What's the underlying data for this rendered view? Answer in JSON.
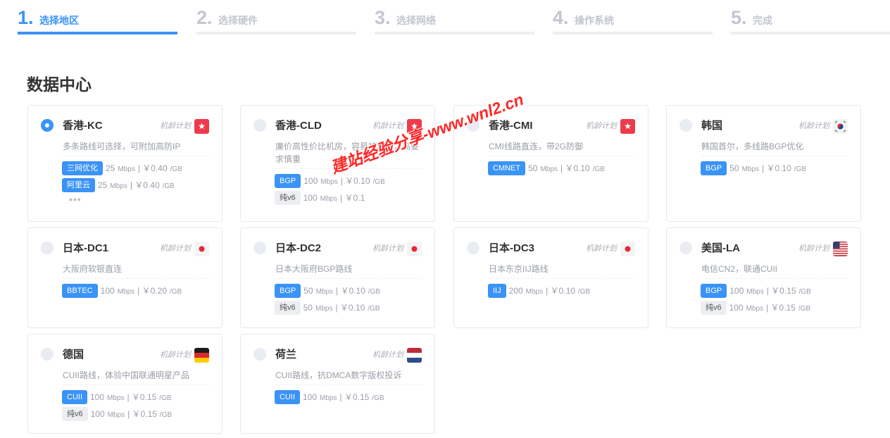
{
  "steps": [
    {
      "num": "1.",
      "label": "选择地区",
      "active": true
    },
    {
      "num": "2.",
      "label": "选择硬件",
      "active": false
    },
    {
      "num": "3.",
      "label": "选择网络",
      "active": false
    },
    {
      "num": "4.",
      "label": "操作系统",
      "active": false
    },
    {
      "num": "5.",
      "label": "完成",
      "active": false
    }
  ],
  "section_title": "数据中心",
  "watermark": "建站经验分享-www.wnl2.cn",
  "colors": {
    "accent": "#3a93f7",
    "muted": "#c3c6cf"
  },
  "datacenters": [
    {
      "name": "香港-KC",
      "plan": "机龄计划",
      "flag": "hk-flag-icon",
      "selected": true,
      "desc": "多条路线可选择，可附加高防IP",
      "lines": [
        {
          "tag": "三网优化",
          "speed": "25",
          "unit": "Mbps",
          "price": "| ￥0.40",
          "per": "/GB"
        },
        {
          "tag": "阿里云",
          "speed": "25",
          "unit": "Mbps",
          "price": "| ￥0.40",
          "per": "/GB"
        }
      ],
      "more": "•••"
    },
    {
      "name": "香港-CLD",
      "plan": "机龄计划",
      "flag": "hk-flag-icon",
      "selected": false,
      "desc": "廉价高性价比机房，容易被攻击，高要求慎重",
      "lines": [
        {
          "tag": "BGP",
          "speed": "100",
          "unit": "Mbps",
          "price": "| ￥0.10",
          "per": "/GB"
        },
        {
          "tag": "纯v6",
          "speed": "100",
          "unit": "Mbps",
          "price": "| ￥0.1",
          "per": "",
          "gray": true
        }
      ]
    },
    {
      "name": "香港-CMI",
      "plan": "机龄计划",
      "flag": "hk-flag-icon",
      "selected": false,
      "desc": "CMI线路直连，带2G防御",
      "lines": [
        {
          "tag": "CMNET",
          "speed": "50",
          "unit": "Mbps",
          "price": "| ￥0.10",
          "per": "/GB"
        }
      ]
    },
    {
      "name": "韩国",
      "plan": "机龄计划",
      "flag": "kr-flag-icon",
      "selected": false,
      "desc": "韩国首尔，多线路BGP优化",
      "lines": [
        {
          "tag": "BGP",
          "speed": "50",
          "unit": "Mbps",
          "price": "| ￥0.10",
          "per": "/GB"
        }
      ]
    },
    {
      "name": "日本-DC1",
      "plan": "机龄计划",
      "flag": "jp-flag-icon",
      "selected": false,
      "desc": "大阪府软银直连",
      "lines": [
        {
          "tag": "BBTEC",
          "speed": "100",
          "unit": "Mbps",
          "price": "| ￥0.20",
          "per": "/GB"
        }
      ]
    },
    {
      "name": "日本-DC2",
      "plan": "机龄计划",
      "flag": "jp-flag-icon",
      "selected": false,
      "desc": "日本大阪府BGP路线",
      "lines": [
        {
          "tag": "BGP",
          "speed": "50",
          "unit": "Mbps",
          "price": "| ￥0.10",
          "per": "/GB"
        },
        {
          "tag": "纯v6",
          "speed": "50",
          "unit": "Mbps",
          "price": "| ￥0.10",
          "per": "/GB",
          "gray": true
        }
      ]
    },
    {
      "name": "日本-DC3",
      "plan": "机龄计划",
      "flag": "jp-flag-icon",
      "selected": false,
      "desc": "日本东京IIJ路线",
      "lines": [
        {
          "tag": "IIJ",
          "speed": "200",
          "unit": "Mbps",
          "price": "| ￥0.10",
          "per": "/GB"
        }
      ]
    },
    {
      "name": "美国-LA",
      "plan": "机龄计划",
      "flag": "us-flag-icon",
      "selected": false,
      "desc": "电信CN2，联通CUII",
      "lines": [
        {
          "tag": "BGP",
          "speed": "100",
          "unit": "Mbps",
          "price": "| ￥0.15",
          "per": "/GB"
        },
        {
          "tag": "纯v6",
          "speed": "100",
          "unit": "Mbps",
          "price": "| ￥0.15",
          "per": "/GB",
          "gray": true
        }
      ]
    },
    {
      "name": "德国",
      "plan": "机龄计划",
      "flag": "de-flag-icon",
      "selected": false,
      "desc": "CUII路线，体验中国联通明星产品",
      "lines": [
        {
          "tag": "CUII",
          "speed": "100",
          "unit": "Mbps",
          "price": "| ￥0.15",
          "per": "/GB"
        },
        {
          "tag": "纯v6",
          "speed": "100",
          "unit": "Mbps",
          "price": "| ￥0.15",
          "per": "/GB",
          "gray": true
        }
      ]
    },
    {
      "name": "荷兰",
      "plan": "机龄计划",
      "flag": "nl-flag-icon",
      "selected": false,
      "desc": "CUII路线，抗DMCA数字版权投诉",
      "lines": [
        {
          "tag": "CUII",
          "speed": "100",
          "unit": "Mbps",
          "price": "| ￥0.15",
          "per": "/GB"
        }
      ]
    }
  ]
}
